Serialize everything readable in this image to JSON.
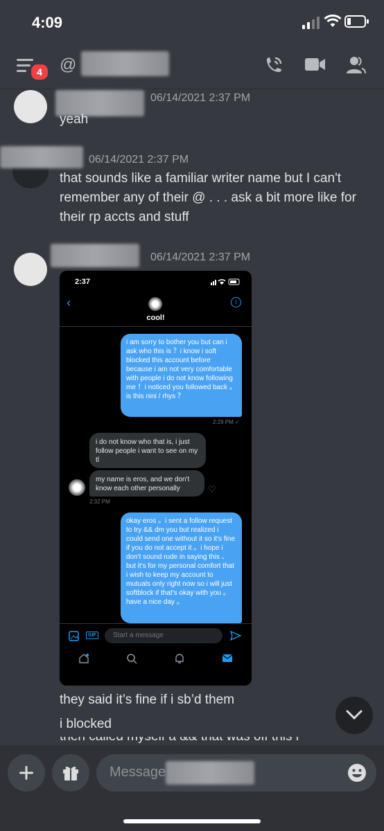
{
  "status_bar": {
    "time": "4:09"
  },
  "header": {
    "badge_count": "4",
    "at_symbol": "@"
  },
  "messages": [
    {
      "timestamp": "06/14/2021 2:37 PM",
      "text": "yeah"
    },
    {
      "timestamp": "06/14/2021 2:37 PM",
      "text": "that sounds like a familiar writer name but I can't remember any of their @ . . . ask a bit more like for their rp accts and stuff"
    },
    {
      "timestamp": "06/14/2021 2:37 PM"
    }
  ],
  "embedded": {
    "time": "2:37",
    "contact_name": "cool!",
    "sent_1": "i am sorry to bother you but can i ask who this is ？i know i soft blocked this account before because i am not very comfortable with people i do not know following me ！i noticed you followed back 。is this nini / rhys ？",
    "sent_1_time": "2:29 PM ✓",
    "recv_1": "i do not know who that is, i just follow people i want to see on my tl",
    "recv_2": "my name is eros, and we don't know each other personally",
    "recv_time": "2:32 PM",
    "sent_2": "okay eros 。i sent a follow request to try && dm you but realized i could send one without it so it's fine if you do not accept it 。i hope i don't sound rude in saying this 、 but it's for my personal comfort that i wish to keep my account to mutuals only right now so i will just softblock if that's okay with you 。have a nice day 。",
    "compose_placeholder": "Start a message",
    "gif_label": "GIF"
  },
  "followups": [
    "they said it’s fine if i sb’d them",
    "i blocked",
    "then called myself a && that was off this i"
  ],
  "composer": {
    "placeholder": "Message"
  }
}
